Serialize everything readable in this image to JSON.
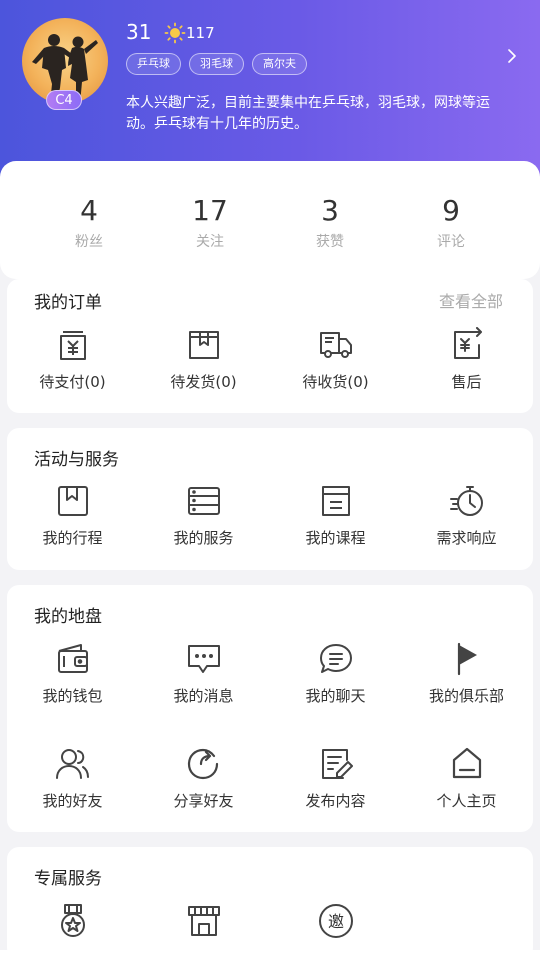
{
  "profile": {
    "level": "C4",
    "number": "31",
    "sun_count": "117",
    "tags": [
      "乒乓球",
      "羽毛球",
      "高尔夫"
    ],
    "bio": "本人兴趣广泛，目前主要集中在乒乓球，羽毛球，网球等运动。乒乓球有十几年的历史。"
  },
  "stats": [
    {
      "value": "4",
      "label": "粉丝"
    },
    {
      "value": "17",
      "label": "关注"
    },
    {
      "value": "3",
      "label": "获赞"
    },
    {
      "value": "9",
      "label": "评论"
    }
  ],
  "orders": {
    "title": "我的订单",
    "view_all": "查看全部",
    "items": [
      {
        "label": "待支付(0)",
        "icon": "yuan-box-icon"
      },
      {
        "label": "待发货(0)",
        "icon": "package-icon"
      },
      {
        "label": "待收货(0)",
        "icon": "truck-icon"
      },
      {
        "label": "售后",
        "icon": "refund-icon"
      }
    ]
  },
  "activities": {
    "title": "活动与服务",
    "items": [
      {
        "label": "我的行程",
        "icon": "bookmark-box-icon"
      },
      {
        "label": "我的服务",
        "icon": "server-list-icon"
      },
      {
        "label": "我的课程",
        "icon": "folder-icon"
      },
      {
        "label": "需求响应",
        "icon": "timer-icon"
      }
    ]
  },
  "territory": {
    "title": "我的地盘",
    "items": [
      {
        "label": "我的钱包",
        "icon": "wallet-icon"
      },
      {
        "label": "我的消息",
        "icon": "message-bubble-icon"
      },
      {
        "label": "我的聊天",
        "icon": "chat-icon"
      },
      {
        "label": "我的俱乐部",
        "icon": "flag-icon"
      },
      {
        "label": "我的好友",
        "icon": "friends-icon"
      },
      {
        "label": "分享好友",
        "icon": "share-icon"
      },
      {
        "label": "发布内容",
        "icon": "edit-doc-icon"
      },
      {
        "label": "个人主页",
        "icon": "home-icon"
      }
    ]
  },
  "exclusive": {
    "title": "专属服务",
    "items": [
      {
        "icon": "medal-icon"
      },
      {
        "icon": "store-icon"
      },
      {
        "label": "邀",
        "icon": "invite-icon"
      }
    ]
  }
}
